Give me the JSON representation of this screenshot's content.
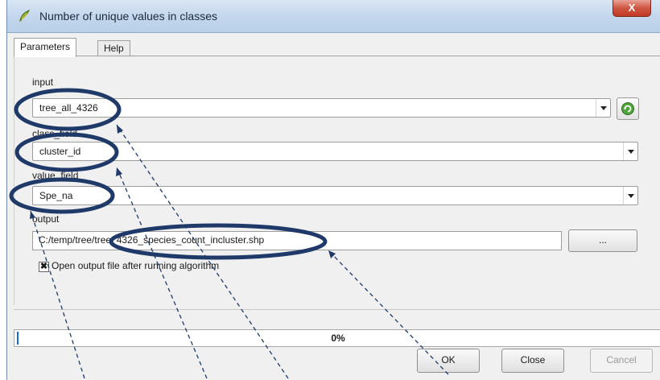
{
  "window": {
    "title": "Number of unique values in classes",
    "close_glyph": "X"
  },
  "tabs": [
    {
      "label": "Parameters",
      "active": true
    },
    {
      "label": "Help",
      "active": false
    }
  ],
  "params": {
    "input_label": "input",
    "input_value": "tree_all_4326",
    "class_field_label": "class_field",
    "class_field_value": "cluster_id",
    "value_field_label": "value_field",
    "value_field_value": "Spe_na",
    "output_label": "output",
    "output_value": "C:/temp/tree/tree_4326_species_count_incluster.shp",
    "browse_label": "...",
    "open_output_label": "Open output file after running algorithm",
    "open_output_checked": true,
    "check_glyph": "✖"
  },
  "progress": {
    "value": 0,
    "text": "0%"
  },
  "buttons": {
    "ok": "OK",
    "close": "Close",
    "cancel": "Cancel"
  },
  "icons": {
    "title": "qgis-icon",
    "refresh": "refresh-icon"
  },
  "colors": {
    "annotation": "#1f3a68",
    "progress": "#1b6ad4"
  }
}
